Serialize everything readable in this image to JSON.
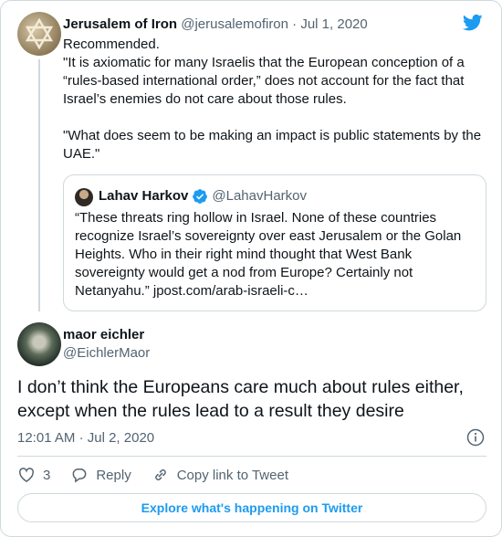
{
  "colors": {
    "accent": "#1d9bf0",
    "text": "#0f1419",
    "muted": "#536471",
    "border": "#cfd9de"
  },
  "quoted_retweet": {
    "author_name": "Jerusalem of Iron",
    "author_handle": "@jerusalemofiron",
    "separator": "·",
    "date": "Jul 1, 2020",
    "avatar_icon": "star-of-david-icon",
    "body_lines": [
      "Recommended.",
      "\"It is axiomatic for many Israelis that the European conception of a “rules-based international order,” does not account for the fact that Israel’s enemies do not care about those rules.",
      "\"What does seem to be making an impact is public statements by the UAE.\""
    ],
    "quote": {
      "author_name": "Lahav Harkov",
      "author_handle": "@LahavHarkov",
      "verified_icon": "verified-badge-icon",
      "text": "“These threats ring hollow in Israel. None of these countries recognize Israel’s sovereignty over east Jerusalem or the Golan Heights. Who in their right mind thought that West Bank sovereignty would get a nod from Europe? Certainly not Netanyahu.” jpost.com/arab-israeli-c…"
    }
  },
  "tweet": {
    "author_name": "maor eichler",
    "author_handle": "@EichlerMaor",
    "text": "I don’t think the Europeans care much about rules either, except when the rules lead to a result they desire",
    "time": "12:01 AM",
    "separator": "·",
    "date": "Jul 2, 2020",
    "likes": "3",
    "reply_label": "Reply",
    "copy_link_label": "Copy link to Tweet",
    "info_icon": "info-icon"
  },
  "explore_label": "Explore what's happening on Twitter",
  "logo_icon": "twitter-bird-icon"
}
